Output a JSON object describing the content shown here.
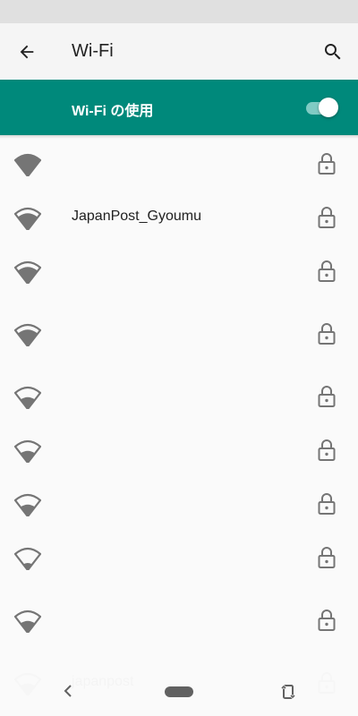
{
  "app_bar": {
    "title": "Wi-Fi"
  },
  "master_switch": {
    "label": "Wi-Fi の使用",
    "enabled": true
  },
  "colors": {
    "accent": "#00897b",
    "icon": "#757575",
    "text": "#212121"
  },
  "networks": [
    {
      "ssid": "",
      "signal": "full",
      "secured": true
    },
    {
      "ssid": "JapanPost_Gyoumu",
      "signal": "high",
      "secured": true
    },
    {
      "ssid": "",
      "signal": "high",
      "secured": true
    },
    {
      "ssid": "",
      "signal": "high",
      "secured": true
    },
    {
      "ssid": "",
      "signal": "medium",
      "secured": true
    },
    {
      "ssid": "",
      "signal": "medium",
      "secured": true
    },
    {
      "ssid": "",
      "signal": "medium",
      "secured": true
    },
    {
      "ssid": "",
      "signal": "low",
      "secured": true
    },
    {
      "ssid": "",
      "signal": "medium",
      "secured": true
    },
    {
      "ssid": "japanpost",
      "signal": "medium",
      "secured": true
    }
  ],
  "nav_bar": {
    "icons": [
      "back-icon",
      "home-pill",
      "rotate-icon"
    ]
  }
}
